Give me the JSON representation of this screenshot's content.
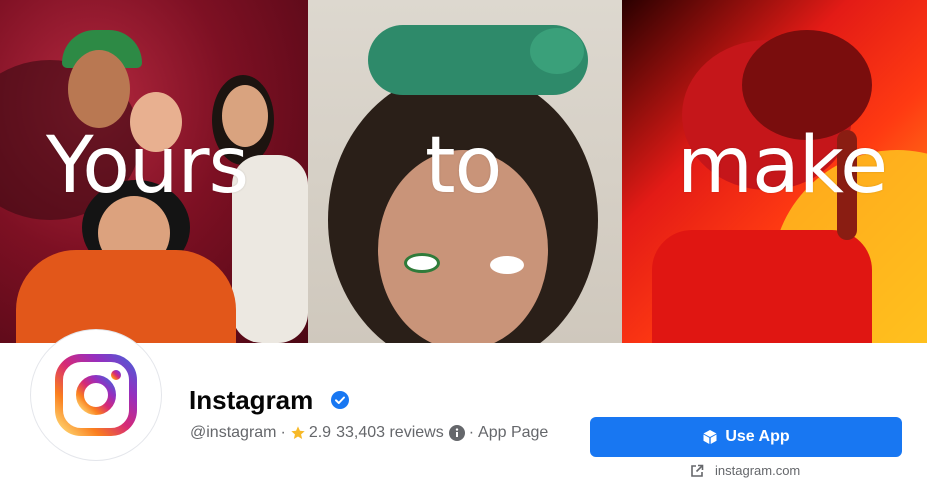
{
  "cover": {
    "words": [
      "Yours",
      "to",
      "make"
    ]
  },
  "profile": {
    "name": "Instagram",
    "handle": "@instagram",
    "separator": "·",
    "rating": "2.9",
    "reviews": "33,403 reviews",
    "category": "App Page",
    "verified": true,
    "verified_color": "#1877f2"
  },
  "actions": {
    "use_app_label": "Use App",
    "website": "instagram.com",
    "accent": "#1877f2"
  },
  "icons": [
    "instagram-logo-icon",
    "verified-badge-icon",
    "star-icon",
    "info-icon",
    "cube-icon",
    "external-link-icon"
  ]
}
